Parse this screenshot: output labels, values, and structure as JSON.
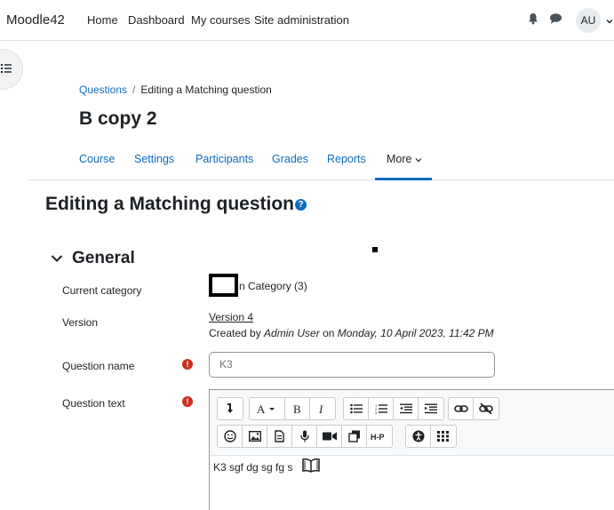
{
  "navbar": {
    "brand": "Moodle42",
    "links": [
      "Home",
      "Dashboard",
      "My courses",
      "Site administration"
    ],
    "avatar": "AU"
  },
  "breadcrumb": {
    "parent": "Questions",
    "separator": "/",
    "current": "Editing a Matching question"
  },
  "page_title": "B copy 2",
  "secondary_nav": [
    "Course",
    "Settings",
    "Participants",
    "Grades",
    "Reports",
    "More"
  ],
  "main_heading": "Editing a Matching question",
  "section": {
    "title": "General",
    "current_category_label": "Current category",
    "current_category_value": "n Category (3)",
    "version_label": "Version",
    "version_link": "Version 4",
    "created_prefix": "Created by ",
    "created_user": "Admin User",
    "created_mid": " on ",
    "created_date": "Monday, 10 April 2023, 11:42 PM",
    "question_name_label": "Question name",
    "question_name_value": "K3",
    "question_text_label": "Question text",
    "question_text_value": "K3 sgf dg sg fg s"
  },
  "colors": {
    "link": "#0f6cbf",
    "required": "#ca3120"
  }
}
